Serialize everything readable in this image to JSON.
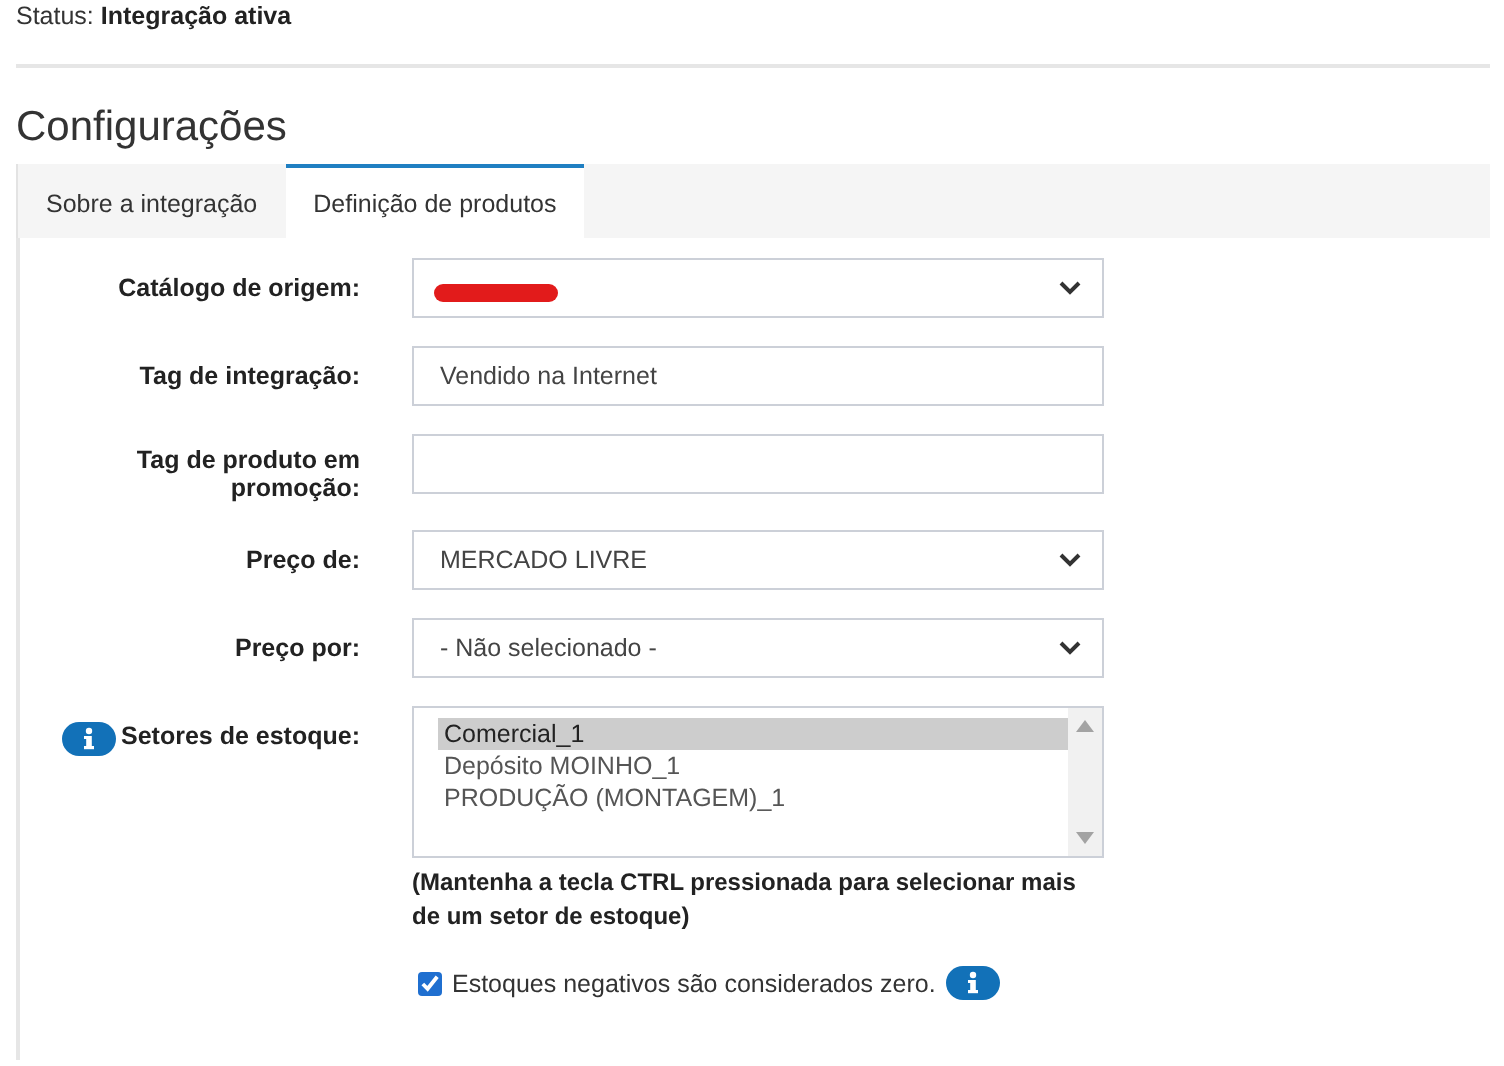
{
  "status": {
    "label": "Status:",
    "value": "Integração ativa"
  },
  "heading": "Configurações",
  "tabs": [
    {
      "label": "Sobre a integração",
      "selected": false
    },
    {
      "label": "Definição de produtos",
      "selected": true
    }
  ],
  "fields": [
    {
      "kind": "select",
      "label": "Catálogo de origem:",
      "redacted": true
    },
    {
      "kind": "text",
      "label": "Tag de integração:",
      "value": "Vendido na Internet"
    },
    {
      "kind": "text",
      "label": "Tag de produto em promoção:"
    },
    {
      "kind": "select",
      "label": "Preço de:",
      "value": "MERCADO LIVRE"
    },
    {
      "kind": "select",
      "label": "Preço por:",
      "value": "- Não selecionado -"
    },
    {
      "kind": "list",
      "label": "Setores de estoque:",
      "info": true,
      "options": [
        {
          "label": "Comercial_1",
          "selected": true
        },
        {
          "label": "Depósito MOINHO_1",
          "selected": false
        },
        {
          "label": "PRODUÇÃO (MONTAGEM)_1",
          "selected": false
        }
      ],
      "help": "(Mantenha a tecla CTRL pressionada para selecionar mais de um setor de estoque)"
    }
  ],
  "negative_stock": {
    "label": "Estoques negativos são considerados zero.",
    "checked": true,
    "info": true
  }
}
